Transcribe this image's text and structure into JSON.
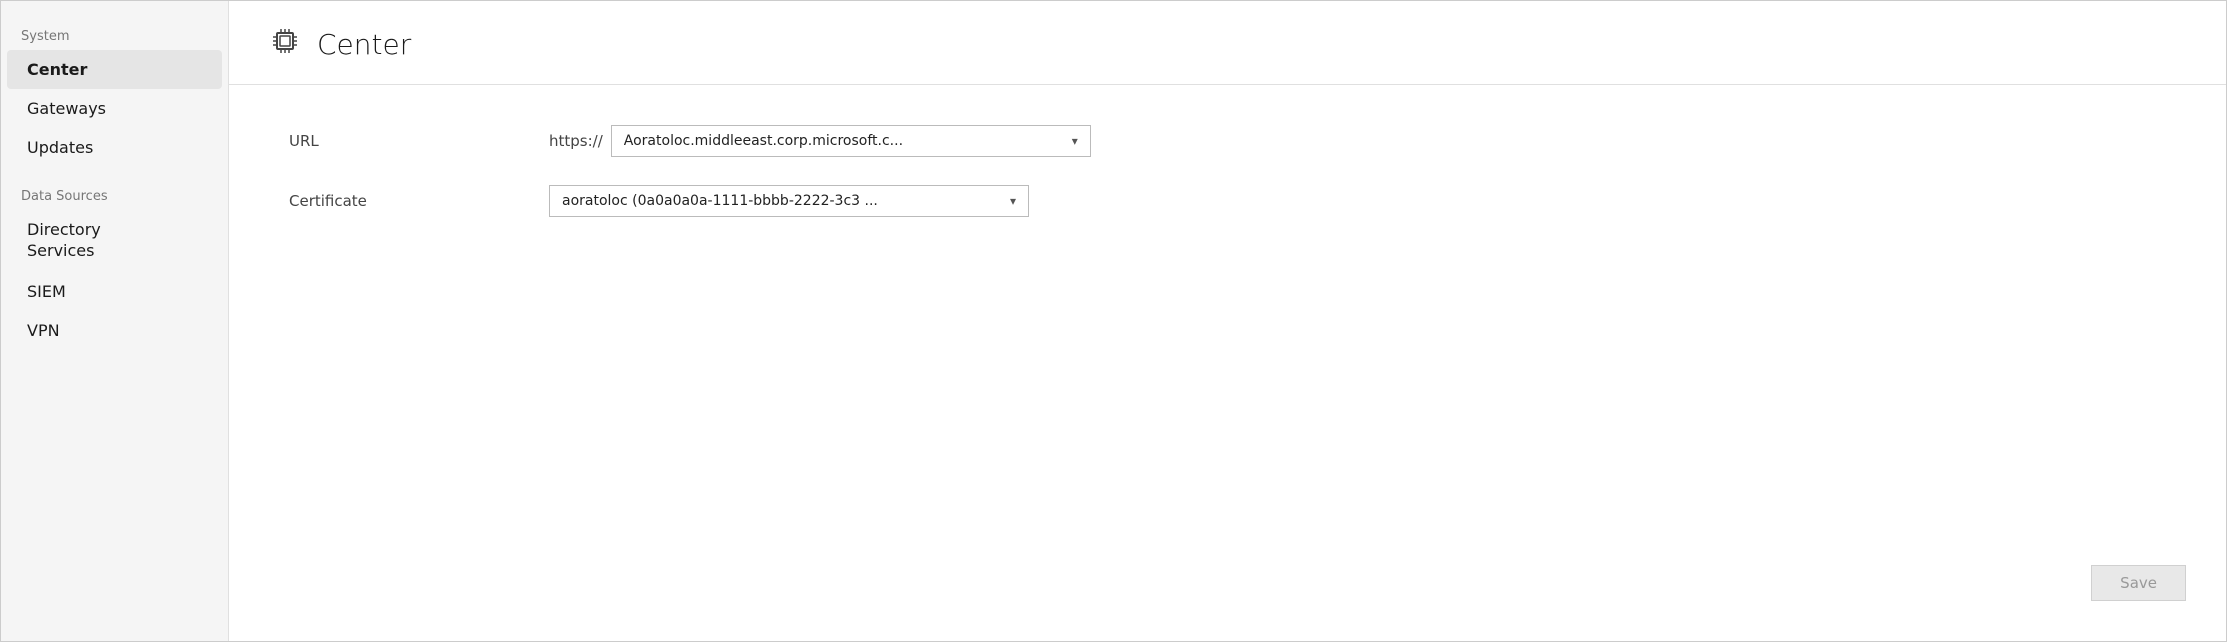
{
  "sidebar": {
    "sections": [
      {
        "label": "System",
        "items": [
          {
            "id": "center",
            "label": "Center",
            "active": true
          },
          {
            "id": "gateways",
            "label": "Gateways",
            "active": false
          },
          {
            "id": "updates",
            "label": "Updates",
            "active": false
          }
        ]
      },
      {
        "label": "Data Sources",
        "items": [
          {
            "id": "directory-services",
            "label": "Directory\nServices",
            "active": false,
            "multiline": true
          },
          {
            "id": "siem",
            "label": "SIEM",
            "active": false
          },
          {
            "id": "vpn",
            "label": "VPN",
            "active": false
          }
        ]
      }
    ]
  },
  "header": {
    "title": "Center",
    "icon": "chip"
  },
  "form": {
    "url_label": "URL",
    "url_prefix": "https://",
    "url_value": "Aoratoloc.middleeast.corp.microsoft.c...",
    "certificate_label": "Certificate",
    "certificate_value": "aoratoloc (0a0a0a0a-1111-bbbb-2222-3c3 ...",
    "save_label": "Save"
  }
}
